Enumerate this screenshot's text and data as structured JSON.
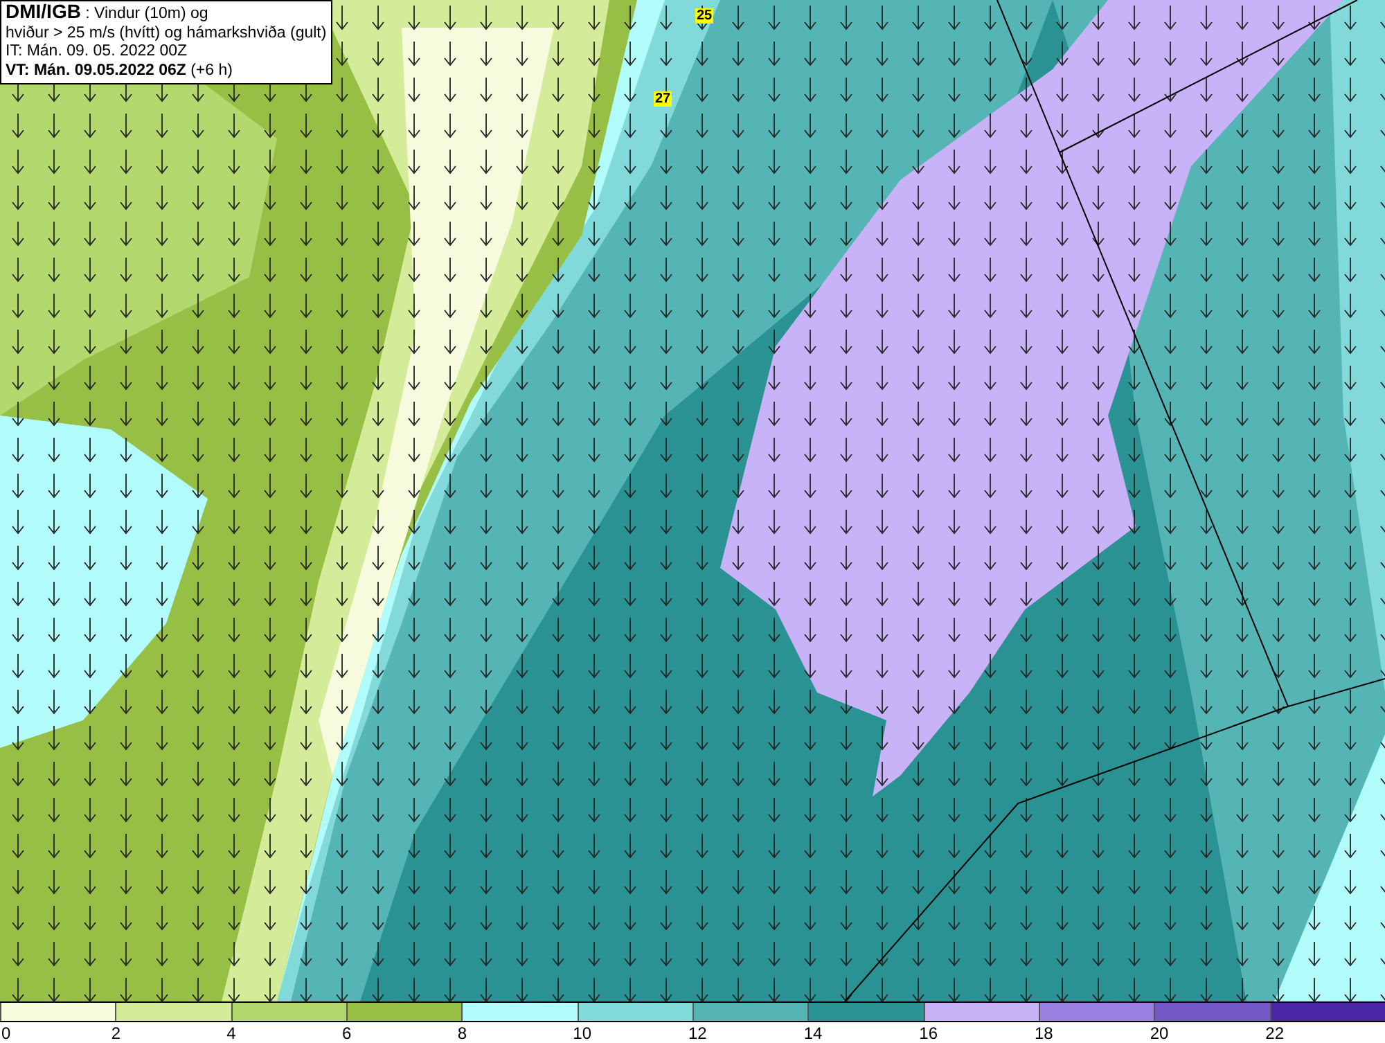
{
  "title_box": {
    "lines": [
      "**DMI/IGB** : Vindur (10m) og",
      "hviður > 25 m/s (hvítt) og hámarkshviða (gult)",
      "IT: Mán. 09. 05. 2022 00Z",
      "**VT: Mán. 09.05.2022 06Z** (+6 h)"
    ]
  },
  "map": {
    "gust_markers": [
      {
        "value": "25"
      },
      {
        "value": "27"
      }
    ]
  },
  "legend": {
    "segments": [
      {
        "label": "0",
        "color": "#f5fbdc"
      },
      {
        "label": "2",
        "color": "#d4ec9a"
      },
      {
        "label": "4",
        "color": "#b3d96e"
      },
      {
        "label": "6",
        "color": "#97bf45"
      },
      {
        "label": "8",
        "color": "#b2fbfb"
      },
      {
        "label": "10",
        "color": "#82d9d9"
      },
      {
        "label": "12",
        "color": "#55b5b5"
      },
      {
        "label": "14",
        "color": "#2a9292"
      },
      {
        "label": "16",
        "color": "#c8b2f8"
      },
      {
        "label": "18",
        "color": "#9a80e0"
      },
      {
        "label": "20",
        "color": "#7458c8"
      },
      {
        "label": "22",
        "color": "#4a28a8"
      }
    ]
  }
}
